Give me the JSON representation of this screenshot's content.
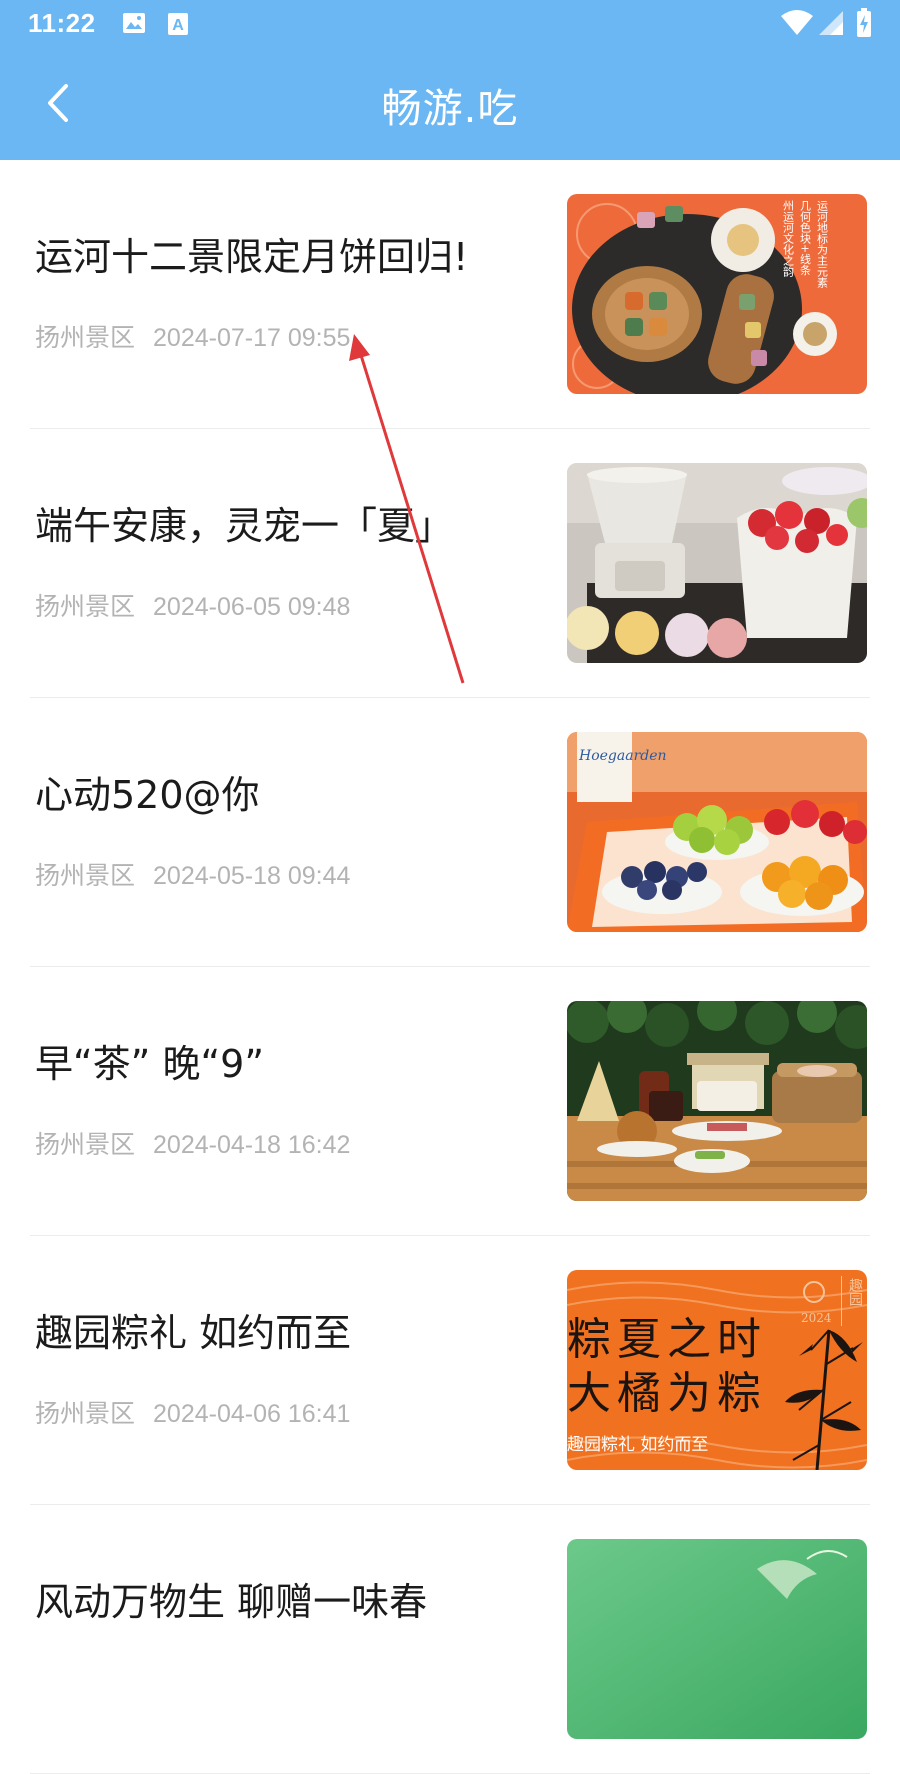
{
  "status_bar": {
    "time": "11:22"
  },
  "header": {
    "title": "畅游.吃"
  },
  "articles": [
    {
      "title": "运河十二景限定月饼回归!",
      "source": "扬州景区",
      "date": "2024-07-17 09:55"
    },
    {
      "title": "端午安康，灵宠一「夏」",
      "source": "扬州景区",
      "date": "2024-06-05 09:48"
    },
    {
      "title": "心动520@你",
      "source": "扬州景区",
      "date": "2024-05-18 09:44"
    },
    {
      "title": "早“茶” 晚“9”",
      "source": "扬州景区",
      "date": "2024-04-18 16:42"
    },
    {
      "title": "趣园粽礼 如约而至",
      "source": "扬州景区",
      "date": "2024-04-06 16:41"
    },
    {
      "title": "风动万物生 聊赠一味春",
      "source": "",
      "date": ""
    }
  ],
  "thumb_text": {
    "mooncake_col1": "运河地标为主元素",
    "mooncake_col2": "几何色块+线条",
    "mooncake_col3": "州运河文化之韵",
    "beer_brand": "Hoegaarden",
    "zongzi_line1": "粽夏之时",
    "zongzi_line2": "大橘为粽",
    "zongzi_line3": "趣园粽礼 如约而至",
    "zongzi_stamp": "趣园",
    "zongzi_year": "2024"
  },
  "colors": {
    "header_bg": "#6ab7f3",
    "title_text": "#1b1b1b",
    "meta_text": "#b3b3b3",
    "annotation_arrow": "#e0393c"
  }
}
